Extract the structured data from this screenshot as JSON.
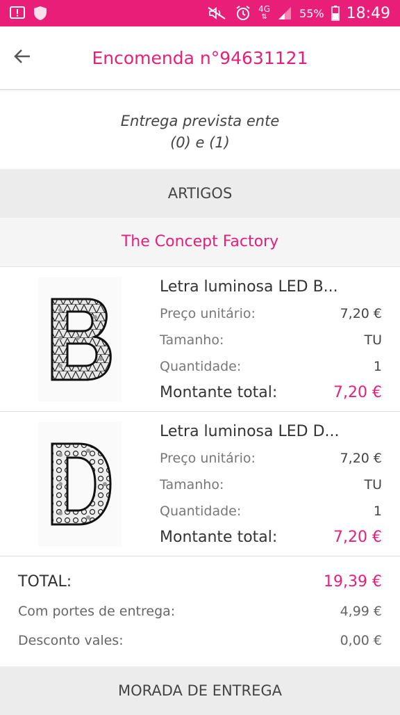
{
  "status": {
    "time": "18:49",
    "battery": "55%",
    "network": "4G",
    "icons": [
      "alert-icon",
      "shield-icon",
      "mute-icon",
      "alarm-icon",
      "network-icon",
      "signal-icon",
      "battery-icon"
    ]
  },
  "header": {
    "title": "Encomenda n°94631121",
    "back_icon": "arrow-back-icon"
  },
  "delivery": {
    "line1": "Entrega prevista ente",
    "line2": "(0) e (1)"
  },
  "articles": {
    "section_title": "ARTIGOS",
    "seller": "The Concept Factory",
    "items": [
      {
        "name": "Letra luminosa LED B...",
        "letter": "B",
        "unit_price_label": "Preço unitário:",
        "unit_price": "7,20 €",
        "size_label": "Tamanho:",
        "size": "TU",
        "qty_label": "Quantidade:",
        "qty": "1",
        "total_label": "Montante total:",
        "total": "7,20 €"
      },
      {
        "name": "Letra luminosa LED D...",
        "letter": "D",
        "unit_price_label": "Preço unitário:",
        "unit_price": "7,20 €",
        "size_label": "Tamanho:",
        "size": "TU",
        "qty_label": "Quantidade:",
        "qty": "1",
        "total_label": "Montante total:",
        "total": "7,20 €"
      }
    ]
  },
  "summary": {
    "total_label": "TOTAL:",
    "total": "19,39 €",
    "shipping_label": "Com portes de entrega:",
    "shipping": "4,99 €",
    "discount_label": "Desconto vales:",
    "discount": "0,00 €"
  },
  "delivery_address": {
    "section_title": "MORADA DE ENTREGA"
  },
  "colors": {
    "accent": "#e91e78",
    "section_bg": "#ececec"
  }
}
